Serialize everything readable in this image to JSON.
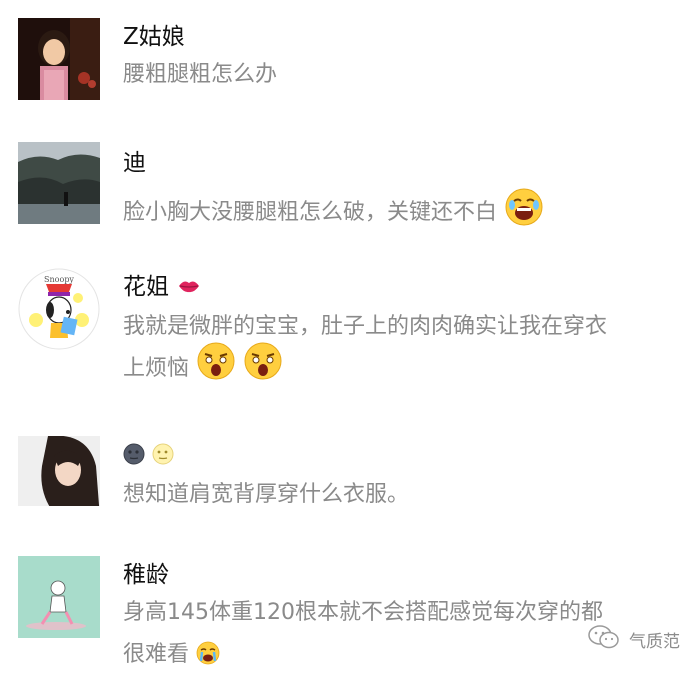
{
  "comments": [
    {
      "name": "Z姑娘",
      "text": "腰粗腿粗怎么办"
    },
    {
      "name": "迪",
      "text": "脸小胸大没腰腿粗怎么破，关键还不白"
    },
    {
      "name": "花姐",
      "text_line1": "我就是微胖的宝宝，肚子上的肉肉确实让我在穿衣",
      "text_line2": "上烦恼"
    },
    {
      "name": "",
      "text": "想知道肩宽背厚穿什么衣服。"
    },
    {
      "name": "稚龄",
      "text_line1": "身高145体重120根本就不会搭配感觉每次穿的都",
      "text_line2": "很难看"
    }
  ],
  "avatars": {
    "snoopy_label": "Snoopy"
  },
  "footer": {
    "account_name": "气质范"
  }
}
